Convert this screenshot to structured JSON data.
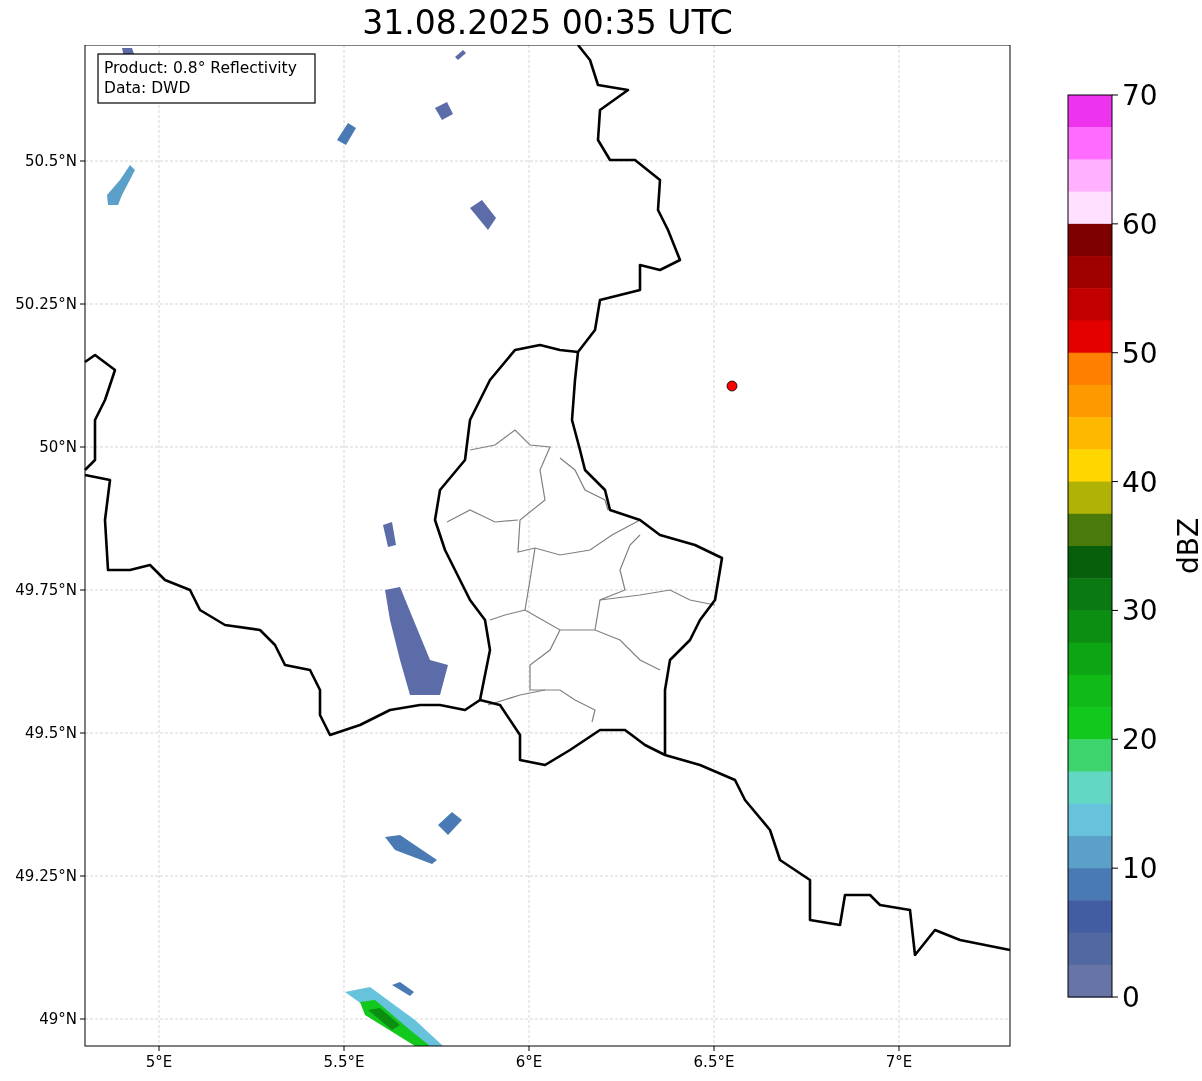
{
  "title": "31.08.2025 00:35 UTC",
  "info_box": [
    "Product: 0.8° Reflectivity",
    "Data: DWD"
  ],
  "x_ticks": [
    "5°E",
    "5.5°E",
    "6°E",
    "6.5°E",
    "7°E"
  ],
  "y_ticks": [
    "50.5°N",
    "50.25°N",
    "50°N",
    "49.75°N",
    "49.5°N",
    "49.25°N",
    "49°N"
  ],
  "colorbar": {
    "label": "dBZ",
    "ticks": [
      "70",
      "60",
      "50",
      "40",
      "30",
      "20",
      "10",
      "0"
    ],
    "bins": [
      {
        "color": "#ee33ee"
      },
      {
        "color": "#ff6cff"
      },
      {
        "color": "#ffb0ff"
      },
      {
        "color": "#ffe0ff"
      },
      {
        "color": "#7f0000"
      },
      {
        "color": "#9f0000"
      },
      {
        "color": "#c20000"
      },
      {
        "color": "#e50000"
      },
      {
        "color": "#ff7f00"
      },
      {
        "color": "#ff9900"
      },
      {
        "color": "#ffb800"
      },
      {
        "color": "#ffd700"
      },
      {
        "color": "#b0b306"
      },
      {
        "color": "#4a7a0b"
      },
      {
        "color": "#075f0c"
      },
      {
        "color": "#0a7912"
      },
      {
        "color": "#0b8e12"
      },
      {
        "color": "#0ea514"
      },
      {
        "color": "#10ba17"
      },
      {
        "color": "#13c81c"
      },
      {
        "color": "#3dd46e"
      },
      {
        "color": "#62d7c4"
      },
      {
        "color": "#66c3db"
      },
      {
        "color": "#5ba0c8"
      },
      {
        "color": "#4a7ab3"
      },
      {
        "color": "#425da1"
      },
      {
        "color": "#5168a0"
      },
      {
        "color": "#6674a6"
      }
    ]
  }
}
